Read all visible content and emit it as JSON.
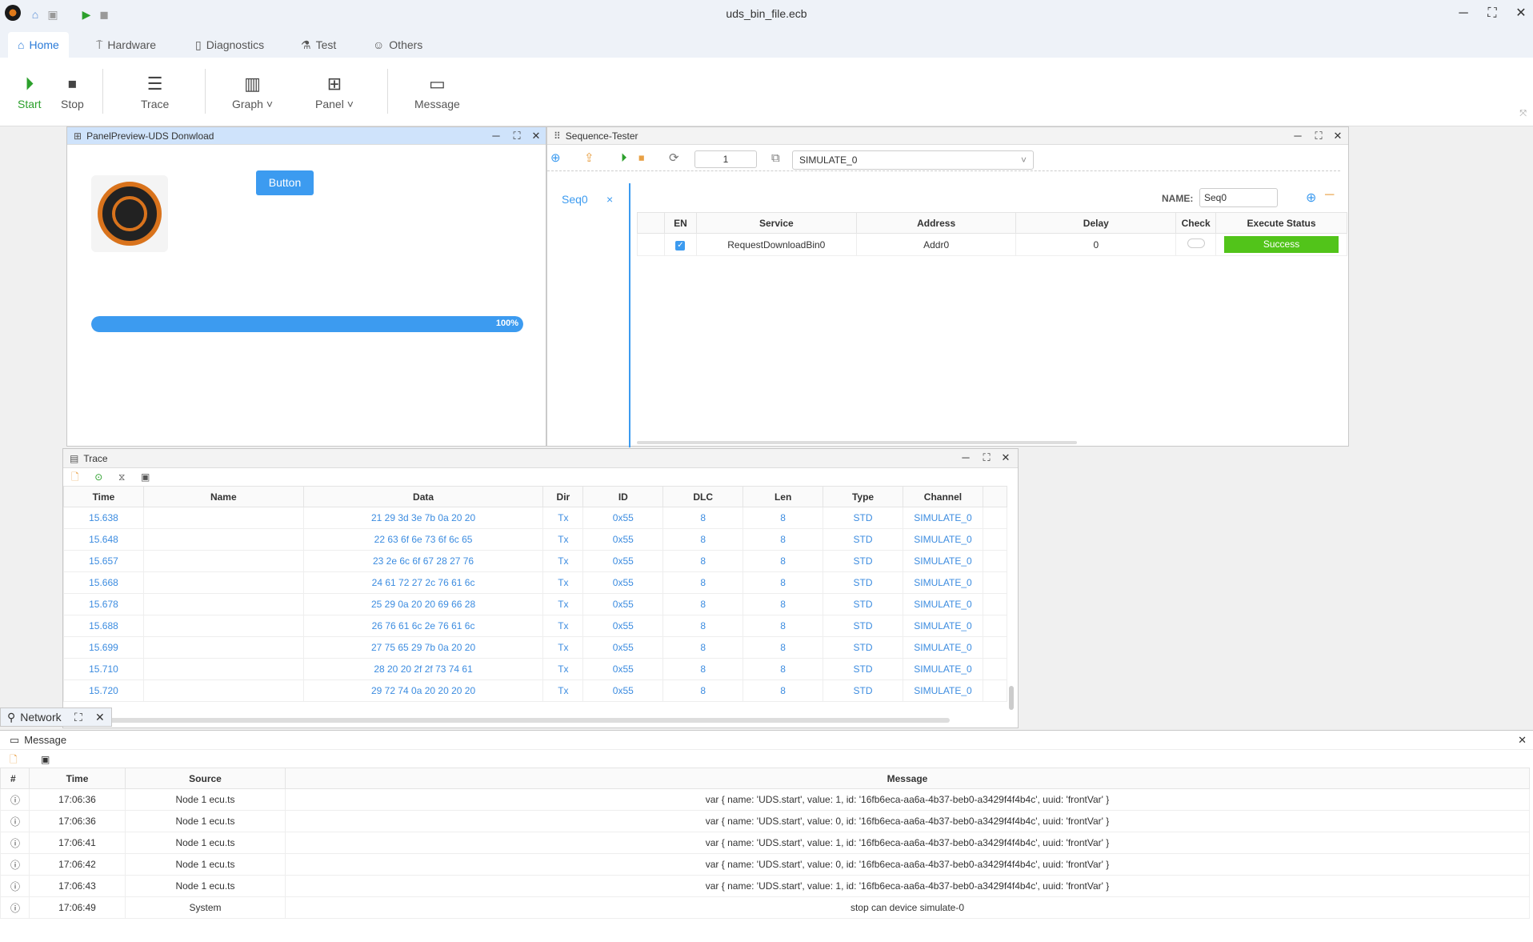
{
  "window": {
    "title": "uds_bin_file.ecb",
    "minimize": "─",
    "maximize": "⛶",
    "close": "✕"
  },
  "menu": {
    "tabs": [
      {
        "label": "Home",
        "icon": "home-icon"
      },
      {
        "label": "Hardware",
        "icon": "hardware-icon"
      },
      {
        "label": "Diagnostics",
        "icon": "diagnostics-icon"
      },
      {
        "label": "Test",
        "icon": "flask-icon"
      },
      {
        "label": "Others",
        "icon": "user-icon"
      }
    ]
  },
  "toolbar": {
    "start": "Start",
    "stop": "Stop",
    "trace": "Trace",
    "graph": "Graph",
    "panel": "Panel",
    "message": "Message"
  },
  "panel_preview": {
    "title": "PanelPreview-UDS Donwload",
    "button_label": "Button",
    "progress_label": "100%",
    "progress_value": 1.0
  },
  "sequence": {
    "title": "Sequence-Tester",
    "repeat_count": "1",
    "device": "SIMULATE_0",
    "tab": "Seq0",
    "name_label": "NAME:",
    "name_value": "Seq0",
    "columns": [
      "EN",
      "Service",
      "Address",
      "Delay",
      "Check",
      "Execute Status"
    ],
    "rows": [
      {
        "service": "RequestDownloadBin0",
        "address": "Addr0",
        "delay": "0",
        "status": "Success"
      }
    ],
    "status_color": "#52c41a"
  },
  "trace": {
    "title": "Trace",
    "columns": [
      "Time",
      "Name",
      "Data",
      "Dir",
      "ID",
      "DLC",
      "Len",
      "Type",
      "Channel"
    ],
    "rows": [
      [
        "15.638",
        "",
        "21 29 3d 3e 7b 0a 20 20",
        "Tx",
        "0x55",
        "8",
        "8",
        "STD",
        "SIMULATE_0"
      ],
      [
        "15.648",
        "",
        "22 63 6f 6e 73 6f 6c 65",
        "Tx",
        "0x55",
        "8",
        "8",
        "STD",
        "SIMULATE_0"
      ],
      [
        "15.657",
        "",
        "23 2e 6c 6f 67 28 27 76",
        "Tx",
        "0x55",
        "8",
        "8",
        "STD",
        "SIMULATE_0"
      ],
      [
        "15.668",
        "",
        "24 61 72 27 2c 76 61 6c",
        "Tx",
        "0x55",
        "8",
        "8",
        "STD",
        "SIMULATE_0"
      ],
      [
        "15.678",
        "",
        "25 29 0a 20 20 69 66 28",
        "Tx",
        "0x55",
        "8",
        "8",
        "STD",
        "SIMULATE_0"
      ],
      [
        "15.688",
        "",
        "26 76 61 6c 2e 76 61 6c",
        "Tx",
        "0x55",
        "8",
        "8",
        "STD",
        "SIMULATE_0"
      ],
      [
        "15.699",
        "",
        "27 75 65 29 7b 0a 20 20",
        "Tx",
        "0x55",
        "8",
        "8",
        "STD",
        "SIMULATE_0"
      ],
      [
        "15.710",
        "",
        "28 20 20 2f 2f 73 74 61",
        "Tx",
        "0x55",
        "8",
        "8",
        "STD",
        "SIMULATE_0"
      ],
      [
        "15.720",
        "",
        "29 72 74 0a 20 20 20 20",
        "Tx",
        "0x55",
        "8",
        "8",
        "STD",
        "SIMULATE_0"
      ]
    ]
  },
  "network": {
    "label": "Network"
  },
  "message": {
    "title": "Message",
    "columns": [
      "#",
      "Time",
      "Source",
      "Message"
    ],
    "rows": [
      [
        "17:06:36",
        "Node 1 ecu.ts",
        "var { name: 'UDS.start', value: 1, id: '16fb6eca-aa6a-4b37-beb0-a3429f4f4b4c', uuid: 'frontVar' }"
      ],
      [
        "17:06:36",
        "Node 1 ecu.ts",
        "var { name: 'UDS.start', value: 0, id: '16fb6eca-aa6a-4b37-beb0-a3429f4f4b4c', uuid: 'frontVar' }"
      ],
      [
        "17:06:41",
        "Node 1 ecu.ts",
        "var { name: 'UDS.start', value: 1, id: '16fb6eca-aa6a-4b37-beb0-a3429f4f4b4c', uuid: 'frontVar' }"
      ],
      [
        "17:06:42",
        "Node 1 ecu.ts",
        "var { name: 'UDS.start', value: 0, id: '16fb6eca-aa6a-4b37-beb0-a3429f4f4b4c', uuid: 'frontVar' }"
      ],
      [
        "17:06:43",
        "Node 1 ecu.ts",
        "var { name: 'UDS.start', value: 1, id: '16fb6eca-aa6a-4b37-beb0-a3429f4f4b4c', uuid: 'frontVar' }"
      ],
      [
        "17:06:49",
        "System",
        "stop can device simulate-0"
      ]
    ]
  }
}
